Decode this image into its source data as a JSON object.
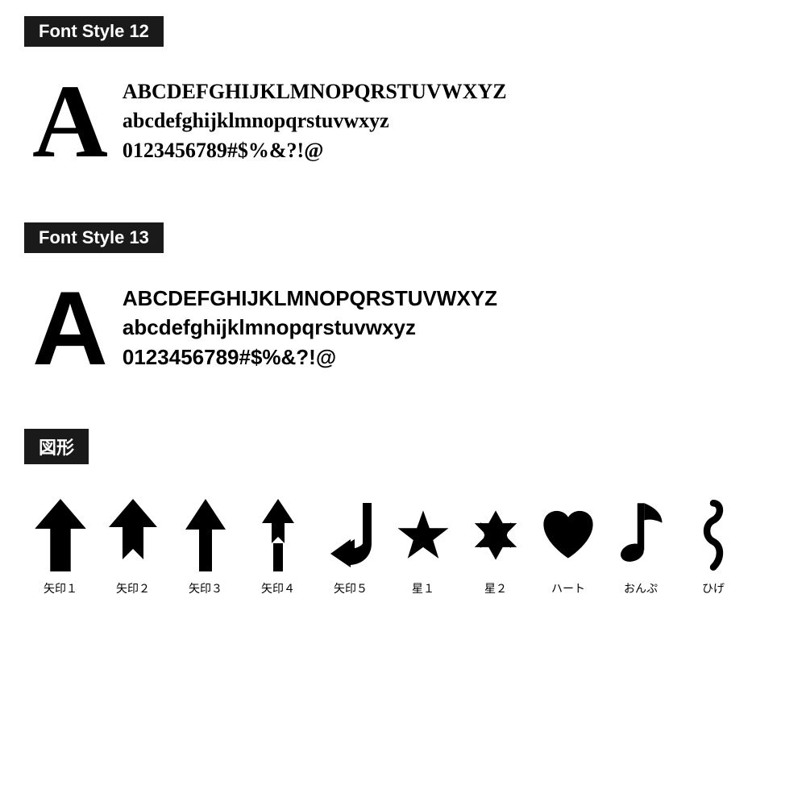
{
  "sections": [
    {
      "id": "font12",
      "label": "Font Style 12",
      "font_class": "serif",
      "big_letter": "A",
      "rows": [
        "ABCDEFGHIJKLMNOPQRSTUVWXYZ",
        "abcdefghijklmnopqrstuvwxyz",
        "0123456789#$%&?!@"
      ]
    },
    {
      "id": "font13",
      "label": "Font Style 13",
      "font_class": "sans",
      "big_letter": "A",
      "rows": [
        "ABCDEFGHIJKLMNOPQRSTUVWXYZ",
        "abcdefghijklmnopqrstuvwxyz",
        "0123456789#$%&?!@"
      ]
    }
  ],
  "shapes_section": {
    "label": "図形",
    "items": [
      {
        "id": "arrow1",
        "label": "矢印１"
      },
      {
        "id": "arrow2",
        "label": "矢印２"
      },
      {
        "id": "arrow3",
        "label": "矢印３"
      },
      {
        "id": "arrow4",
        "label": "矢印４"
      },
      {
        "id": "arrow5",
        "label": "矢印５"
      },
      {
        "id": "star1",
        "label": "星１"
      },
      {
        "id": "star2",
        "label": "星２"
      },
      {
        "id": "heart",
        "label": "ハート"
      },
      {
        "id": "note",
        "label": "おんぷ"
      },
      {
        "id": "hige",
        "label": "ひげ"
      }
    ]
  }
}
